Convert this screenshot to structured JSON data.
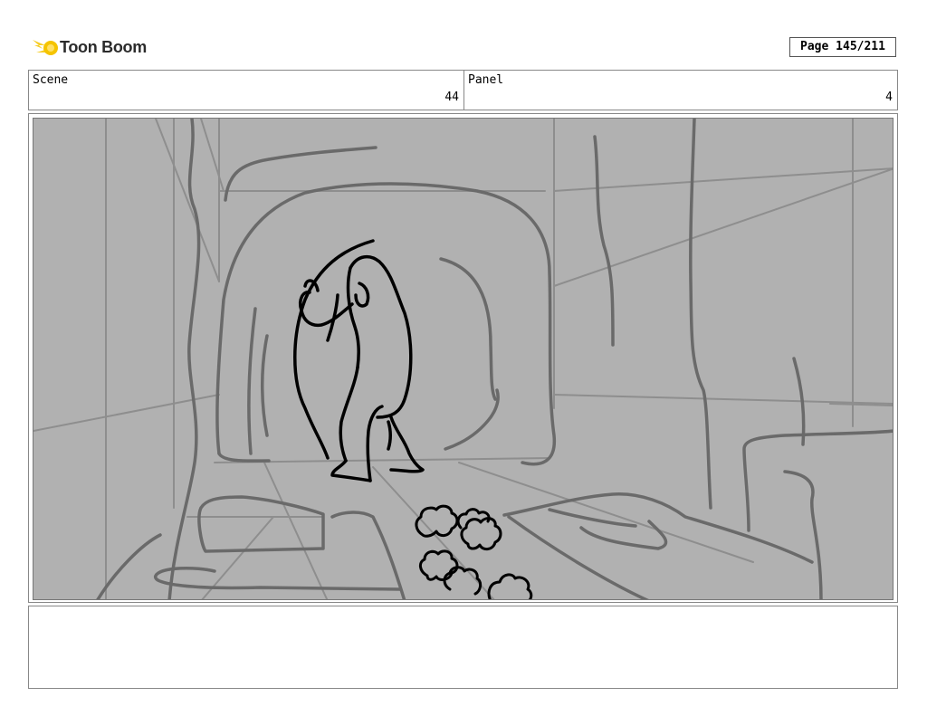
{
  "brand": {
    "name": "Toon Boom",
    "icon": "toon-boom-comet-logo",
    "accent": "#f5c400"
  },
  "page": {
    "label": "Page 145/211"
  },
  "scene": {
    "label": "Scene",
    "value": "44"
  },
  "panel": {
    "label": "Panel",
    "value": "4"
  },
  "drawing": {
    "icon": "storyboard-sketch",
    "background": "#b1b1b1"
  },
  "notes": {
    "text": ""
  }
}
